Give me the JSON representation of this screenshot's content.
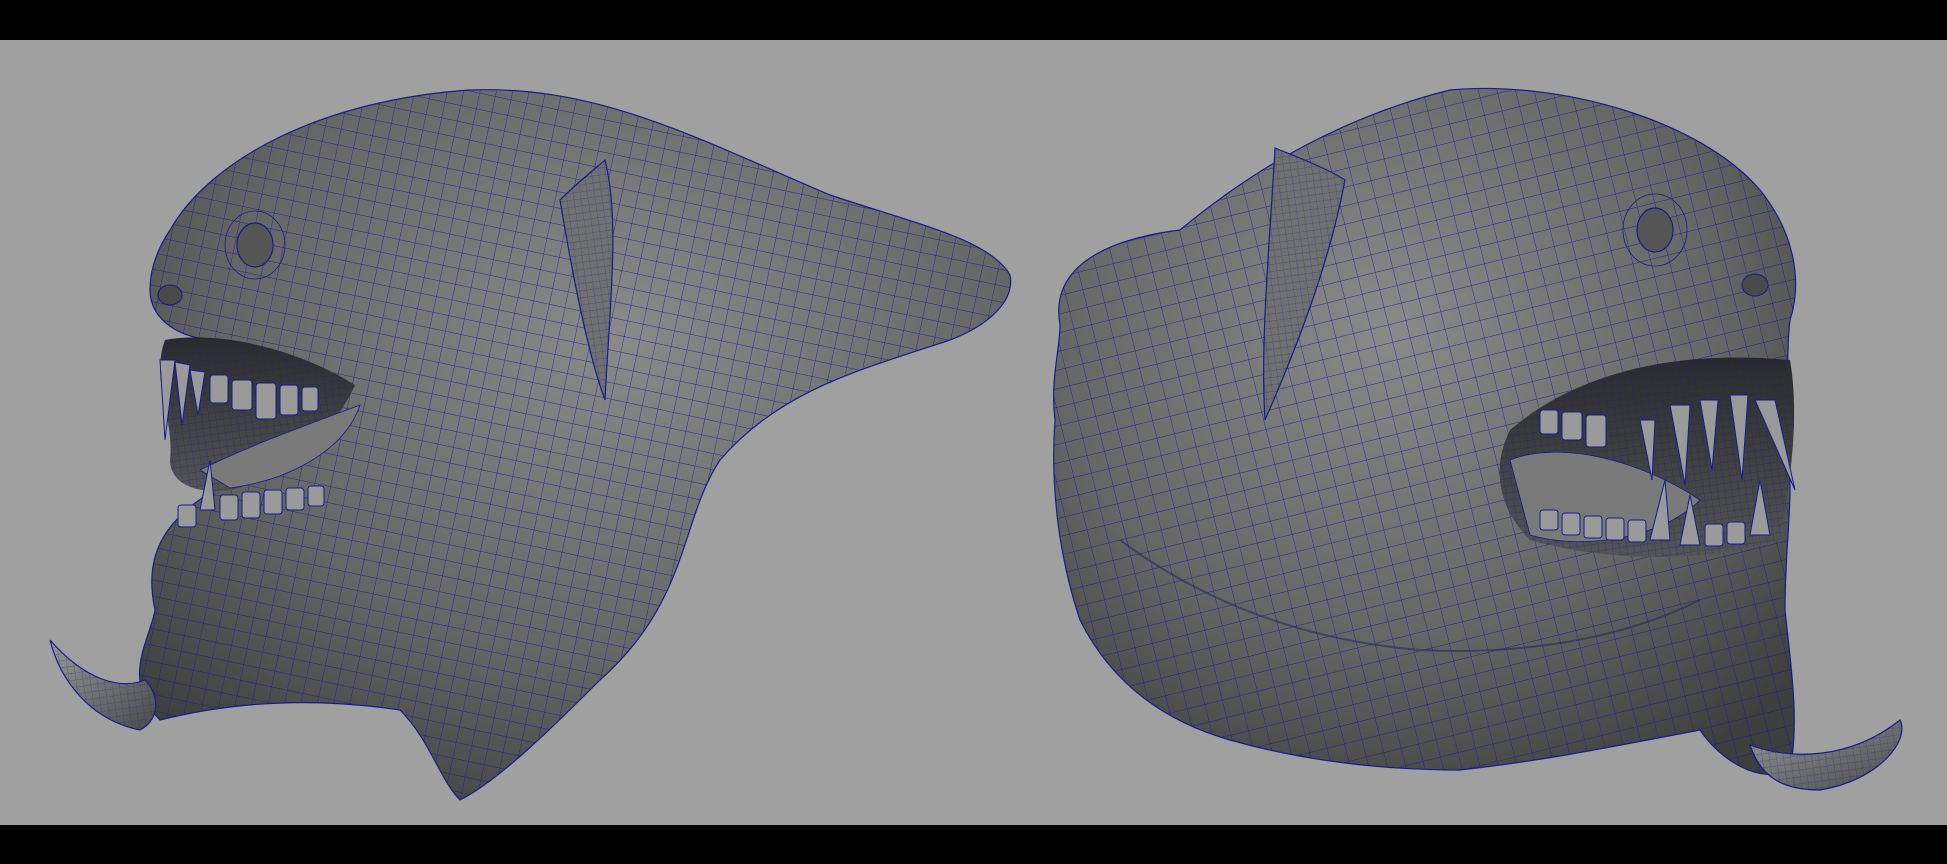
{
  "scene": {
    "viewport_background": "#a0a0a0",
    "letterbox_color": "#000000",
    "wire_color": "#1a1a8c",
    "mesh_shade_dark": "#3e3e3e",
    "mesh_shade_mid": "#6a6a6a",
    "mesh_shade_light": "#8a8a8a",
    "models": [
      {
        "name": "creature-head-left-view",
        "facing": "left"
      },
      {
        "name": "creature-head-right-view",
        "facing": "right"
      }
    ]
  }
}
